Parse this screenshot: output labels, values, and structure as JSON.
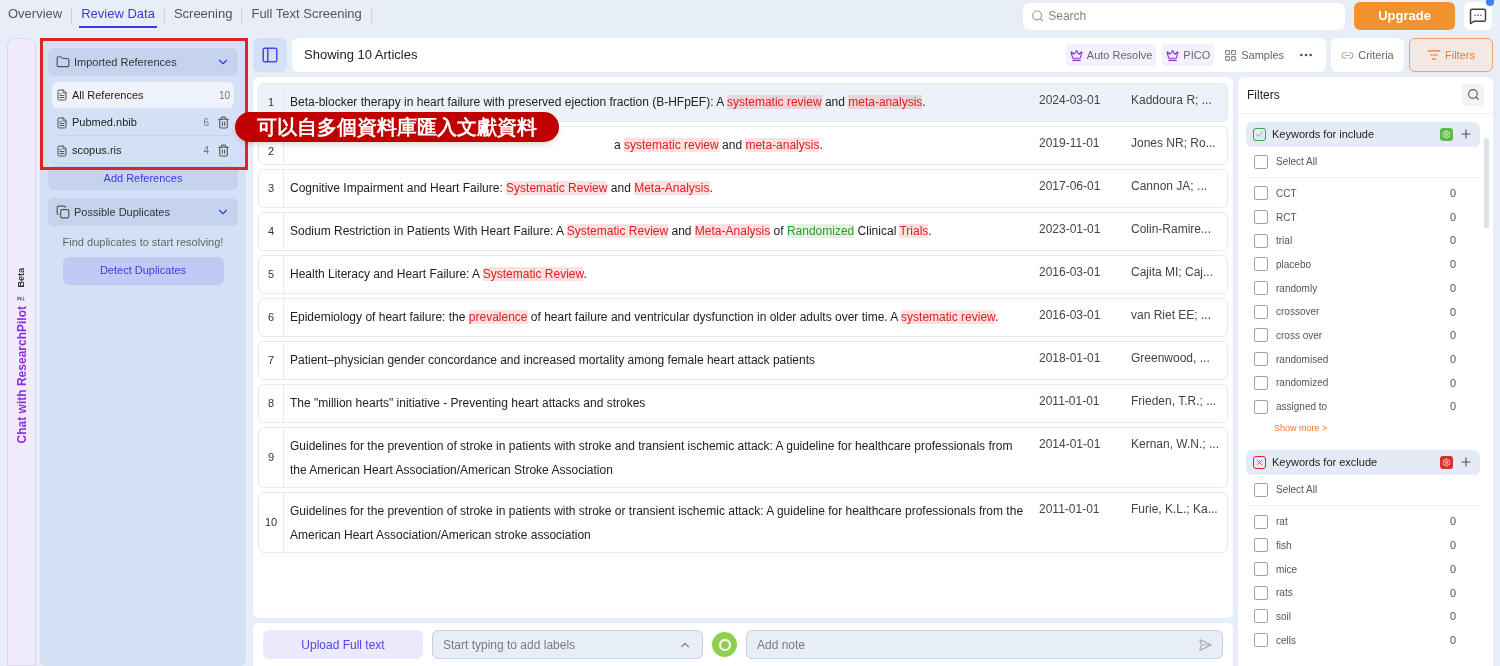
{
  "nav_tabs": [
    {
      "label": "Overview",
      "selected": false
    },
    {
      "label": "Review Data",
      "selected": true
    },
    {
      "label": "Screening",
      "selected": false
    },
    {
      "label": "Full Text Screening",
      "selected": false
    }
  ],
  "search": {
    "placeholder": "Search"
  },
  "upgrade_button": "Upgrade",
  "side_strip": {
    "label": "Chat with ResearchPilot",
    "trademark": "™",
    "badge": "Beta"
  },
  "imported": {
    "title": "Imported References",
    "expanded": true,
    "items": [
      {
        "name": "All References",
        "count": "10",
        "selected": true,
        "deletable": false
      },
      {
        "name": "Pubmed.nbib",
        "count": "6",
        "selected": false,
        "deletable": true
      },
      {
        "name": "scopus.ris",
        "count": "4",
        "selected": false,
        "deletable": true
      }
    ],
    "add_button": "Add References"
  },
  "duplicates": {
    "title": "Possible Duplicates",
    "expanded": true,
    "hint": "Find duplicates to start resolving!",
    "button": "Detect Duplicates"
  },
  "callout": "可以自多個資料庫匯入文獻資料",
  "toolbar": {
    "title": "Showing 10 Articles",
    "actions": [
      {
        "label": "Auto Resolve",
        "kind": "premium"
      },
      {
        "label": "PICO",
        "kind": "premium"
      },
      {
        "label": "Samples",
        "kind": "samples"
      }
    ],
    "criteria": "Criteria",
    "filters": "Filters"
  },
  "articles": [
    {
      "number": "1",
      "selected": true,
      "covered": false,
      "title": [
        {
          "text": "Beta-blocker therapy in heart failure with preserved ejection fraction (B-HFpEF): A "
        },
        {
          "text": "systematic review",
          "color": "#e11d1d"
        },
        {
          "text": " and "
        },
        {
          "text": "meta-analysis",
          "color": "#e11d1d"
        },
        {
          "text": "."
        }
      ],
      "date": "2024-03-01",
      "authors": "Kaddoura R; ..."
    },
    {
      "number": "2",
      "selected": false,
      "covered": true,
      "title": [
        {
          "text": "a "
        },
        {
          "text": "systematic review",
          "color": "#e11d1d"
        },
        {
          "text": " and "
        },
        {
          "text": "meta-analysis",
          "color": "#e11d1d"
        },
        {
          "text": "."
        }
      ],
      "date": "2019-11-01",
      "authors": "Jones NR; Ro..."
    },
    {
      "number": "3",
      "selected": false,
      "covered": false,
      "title": [
        {
          "text": "Cognitive Impairment and Heart Failure: "
        },
        {
          "text": "Systematic Review",
          "color": "#e11d1d"
        },
        {
          "text": " and "
        },
        {
          "text": "Meta-Analysis",
          "color": "#e11d1d"
        },
        {
          "text": "."
        }
      ],
      "date": "2017-06-01",
      "authors": "Cannon JA; ..."
    },
    {
      "number": "4",
      "selected": false,
      "covered": false,
      "title": [
        {
          "text": "Sodium Restriction in Patients With Heart Failure: A "
        },
        {
          "text": "Systematic Review",
          "color": "#e11d1d"
        },
        {
          "text": " and "
        },
        {
          "text": "Meta-Analysis",
          "color": "#e11d1d"
        },
        {
          "text": " of "
        },
        {
          "text": "Randomized",
          "color": "#2f9e2f"
        },
        {
          "text": " Clinical "
        },
        {
          "text": "Trials",
          "color": "#e11d1d"
        },
        {
          "text": "."
        }
      ],
      "date": "2023-01-01",
      "authors": "Colin-Ramire..."
    },
    {
      "number": "5",
      "selected": false,
      "covered": false,
      "title": [
        {
          "text": "Health Literacy and Heart Failure: A "
        },
        {
          "text": "Systematic Review",
          "color": "#e11d1d"
        },
        {
          "text": "."
        }
      ],
      "date": "2016-03-01",
      "authors": "Cajita MI; Caj..."
    },
    {
      "number": "6",
      "selected": false,
      "covered": false,
      "title": [
        {
          "text": "Epidemiology of heart failure: the "
        },
        {
          "text": "prevalence",
          "color": "#e11d1d"
        },
        {
          "text": " of heart failure and ventricular dysfunction in older adults over time. A "
        },
        {
          "text": "systematic review",
          "color": "#e11d1d"
        },
        {
          "text": "."
        }
      ],
      "date": "2016-03-01",
      "authors": "van Riet EE; ..."
    },
    {
      "number": "7",
      "selected": false,
      "covered": false,
      "title": [
        {
          "text": "Patient–physician gender concordance and increased mortality among female heart attack patients"
        }
      ],
      "date": "2018-01-01",
      "authors": "Greenwood, ..."
    },
    {
      "number": "8",
      "selected": false,
      "covered": false,
      "title": [
        {
          "text": "The \"million hearts\" initiative - Preventing heart attacks and strokes"
        }
      ],
      "date": "2011-01-01",
      "authors": "Frieden, T.R.; ..."
    },
    {
      "number": "9",
      "selected": false,
      "covered": false,
      "title": [
        {
          "text": "Guidelines for the prevention of stroke in patients with stroke and transient ischemic attack: A guideline for healthcare professionals from the American Heart Association/American Stroke Association"
        }
      ],
      "date": "2014-01-01",
      "authors": "Kernan, W.N.; ..."
    },
    {
      "number": "10",
      "selected": false,
      "covered": false,
      "title": [
        {
          "text": "Guidelines for the prevention of stroke in patients with stroke or transient ischemic attack: A guideline for healthcare professionals from the American Heart Association/American stroke association"
        }
      ],
      "date": "2011-01-01",
      "authors": "Furie, K.L.; Ka..."
    }
  ],
  "bottom_bar": {
    "upload_button": "Upload Full text",
    "labels_placeholder": "Start typing to add labels",
    "note_placeholder": "Add note"
  },
  "filters_panel": {
    "title": "Filters",
    "groups": [
      {
        "title": "Keywords for include",
        "kind": "include",
        "select_all": "Select All",
        "select_all_checked": false,
        "show_more": "Show more >",
        "keywords": [
          {
            "label": "CCT",
            "count": "0",
            "checked": false
          },
          {
            "label": "RCT",
            "count": "0",
            "checked": false
          },
          {
            "label": "trial",
            "count": "0",
            "checked": false
          },
          {
            "label": "placebo",
            "count": "0",
            "checked": false
          },
          {
            "label": "randomly",
            "count": "0",
            "checked": false
          },
          {
            "label": "crossover",
            "count": "0",
            "checked": false
          },
          {
            "label": "cross over",
            "count": "0",
            "checked": false
          },
          {
            "label": "randomised",
            "count": "0",
            "checked": false
          },
          {
            "label": "randomized",
            "count": "0",
            "checked": false
          },
          {
            "label": "assigned to",
            "count": "0",
            "checked": false
          }
        ]
      },
      {
        "title": "Keywords for exclude",
        "kind": "exclude",
        "select_all": "Select All",
        "select_all_checked": false,
        "keywords": [
          {
            "label": "rat",
            "count": "0",
            "checked": false
          },
          {
            "label": "fish",
            "count": "0",
            "checked": false
          },
          {
            "label": "mice",
            "count": "0",
            "checked": false
          },
          {
            "label": "rats",
            "count": "0",
            "checked": false
          },
          {
            "label": "soil",
            "count": "0",
            "checked": false
          },
          {
            "label": "cells",
            "count": "0",
            "checked": false
          }
        ]
      }
    ]
  }
}
